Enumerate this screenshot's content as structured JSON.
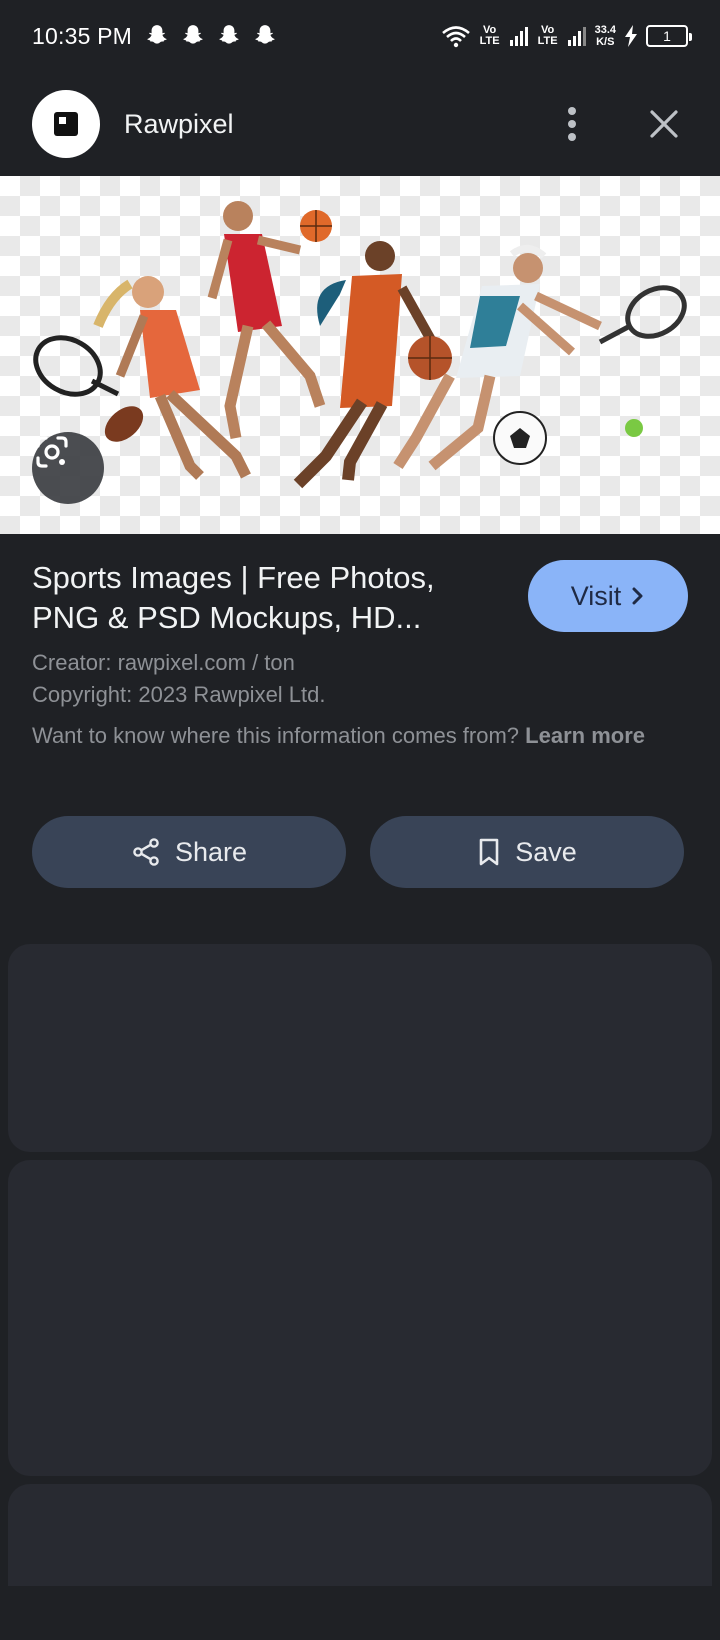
{
  "status_bar": {
    "time": "10:35 PM",
    "volte_1": "Vo LTE",
    "volte_2": "Vo LTE",
    "net_speed_value": "33.4",
    "net_speed_unit": "K/S",
    "battery": "1",
    "icons": [
      "snapchat-icon",
      "snapchat-icon",
      "snapchat-icon",
      "snapchat-icon",
      "wifi-icon",
      "signal-icon",
      "signal-icon",
      "charging-icon",
      "battery-icon"
    ]
  },
  "header": {
    "site_name": "Rawpixel",
    "icons": [
      "rawpixel-logo",
      "more-vert-icon",
      "close-icon"
    ]
  },
  "result": {
    "title": "Sports Images | Free Photos, PNG & PSD Mockups, HD...",
    "visit_label": "Visit",
    "creator": "Creator: rawpixel.com / ton",
    "copyright": "Copyright: 2023 Rawpixel Ltd.",
    "info_question": "Want to know where this information comes from?",
    "learn_more": "Learn more"
  },
  "actions": {
    "share_label": "Share",
    "save_label": "Save"
  },
  "colors": {
    "background": "#1f2125",
    "visit_button": "#8ab4f8",
    "action_button": "#394457",
    "card": "#282a31"
  }
}
